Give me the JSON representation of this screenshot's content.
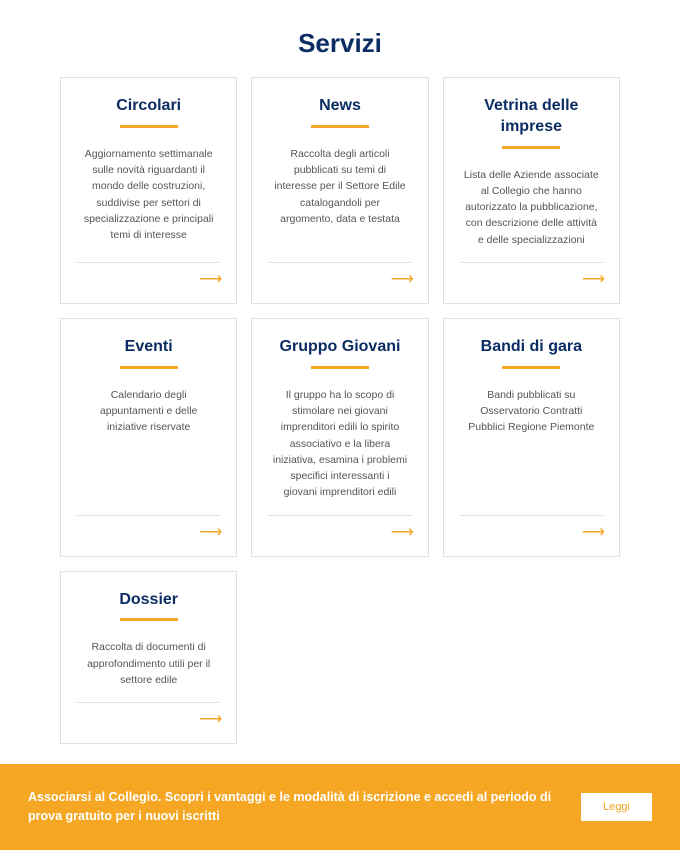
{
  "page_title": "Servizi",
  "cards": [
    {
      "title": "Circolari",
      "desc": "Aggiornamento settimanale sulle novità riguardanti il mondo delle costruzioni, suddivise per settori di specializzazione e principali temi di interesse"
    },
    {
      "title": "News",
      "desc": "Raccolta degli articoli pubblicati su temi di interesse per il Settore Edile catalogandoli per argomento, data e testata"
    },
    {
      "title": "Vetrina delle imprese",
      "desc": "Lista delle Aziende associate al Collegio che hanno autorizzato la pubblicazione, con descrizione delle attività e delle specializzazioni"
    },
    {
      "title": "Eventi",
      "desc": "Calendario degli appuntamenti e delle iniziative riservate"
    },
    {
      "title": "Gruppo Giovani",
      "desc": "Il gruppo ha lo scopo di stimolare nei giovani imprenditori edili lo spirito associativo e la libera iniziativa, esamina i problemi specifici interessanti i giovani imprenditori edili"
    },
    {
      "title": "Bandi di gara",
      "desc": "Bandi pubblicati su Osservatorio Contratti Pubblici Regione Piemonte"
    },
    {
      "title": "Dossier",
      "desc": "Raccolta di documenti di approfondimento utili per il settore edile"
    }
  ],
  "banner": {
    "text": "Associarsi al Collegio. Scopri i vantaggi e le modalità di iscrizione e accedi al periodo di prova gratuito per i nuovi iscritti",
    "button_label": "Leggi"
  }
}
